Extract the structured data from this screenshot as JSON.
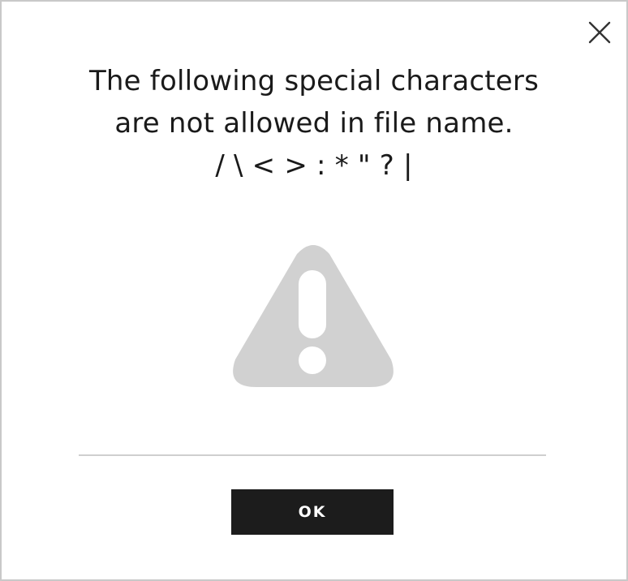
{
  "dialog": {
    "message_lines": [
      "The following special characters",
      "are not allowed in file name.",
      "/ \\ < > : * \" ? |"
    ],
    "ok_label": "OK",
    "close_icon": "close-icon",
    "warning_icon": "warning-icon",
    "warning_icon_color": "#d1d1d1",
    "button_color": "#1c1c1c"
  }
}
